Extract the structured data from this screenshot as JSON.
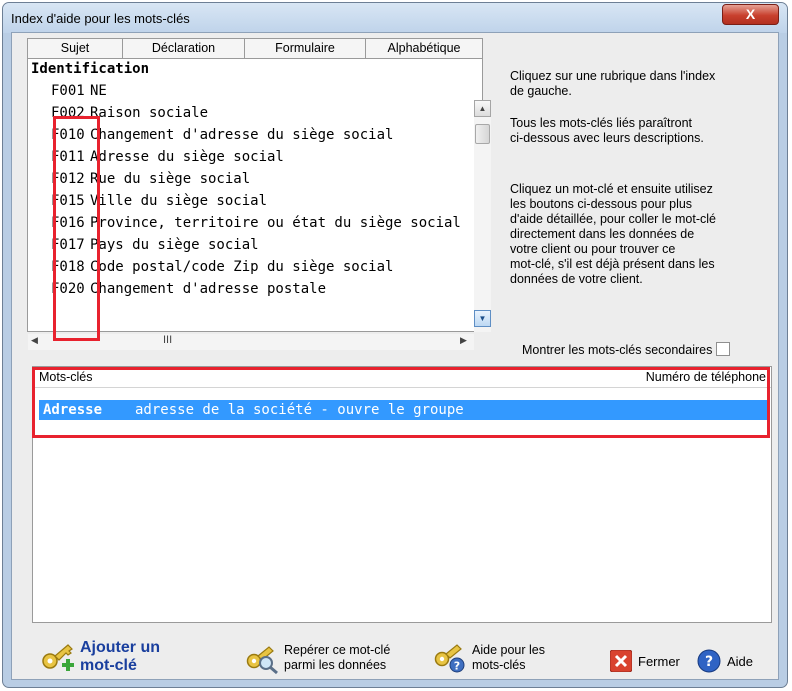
{
  "window": {
    "title": "Index d'aide pour les mots-clés",
    "close_glyph": "X"
  },
  "tabs": [
    "Sujet",
    "Déclaration",
    "Formulaire",
    "Alphabétique"
  ],
  "index": {
    "section": "Identification",
    "entries": [
      {
        "code": "F001",
        "label": "NE"
      },
      {
        "code": "F002",
        "label": "Raison sociale"
      },
      {
        "code": "F010",
        "label": "Changement d'adresse du siège social"
      },
      {
        "code": "F011",
        "label": "Adresse du siège social"
      },
      {
        "code": "F012",
        "label": "Rue du siège social"
      },
      {
        "code": "F015",
        "label": "Ville du siège social"
      },
      {
        "code": "F016",
        "label": "Province, territoire ou état du siège social"
      },
      {
        "code": "F017",
        "label": "Pays du siège social"
      },
      {
        "code": "F018",
        "label": "Code postal/code Zip du siège social"
      },
      {
        "code": "F020",
        "label": "Changement d'adresse postale"
      }
    ]
  },
  "scroll": {
    "h_thumb_glyph": "III"
  },
  "instructions": {
    "line1": [
      "Cliquez sur une rubrique dans l'index",
      "de gauche."
    ],
    "line2": [
      "Tous les mots-clés liés paraîtront",
      "ci-dessous avec leurs descriptions."
    ],
    "line3": [
      "Cliquez un mot-clé et ensuite utilisez",
      "les boutons ci-dessous pour plus",
      "d'aide détaillée, pour coller le mot-clé",
      "directement dans les données de",
      "votre client ou pour trouver ce",
      "mot-clé, s'il est déjà présent dans les",
      "données de votre client."
    ]
  },
  "secondary_label": "Montrer les mots-clés secondaires",
  "keywords": {
    "col_keyword": "Mots-clés",
    "col_phone": "Numéro de téléphone",
    "rows": [
      {
        "keyword": "Adresse",
        "description": "adresse de la société - ouvre le groupe"
      }
    ]
  },
  "buttons": {
    "add_line1": "Ajouter un",
    "add_line2": "mot-clé",
    "find_line1": "Repérer ce mot-clé",
    "find_line2": "parmi les données",
    "help_line1": "Aide pour les",
    "help_line2": "mots-clés",
    "close": "Fermer",
    "help": "Aide"
  },
  "colors": {
    "selection": "#3399ff",
    "highlight_box": "#e8222e",
    "link_blue": "#1a3f9e"
  },
  "icons": [
    "close-icon",
    "scroll-up-icon",
    "scroll-down-icon",
    "scroll-left-icon",
    "scroll-right-icon",
    "key-add-icon",
    "key-search-icon",
    "key-help-icon",
    "close-x-icon",
    "help-circle-icon"
  ]
}
